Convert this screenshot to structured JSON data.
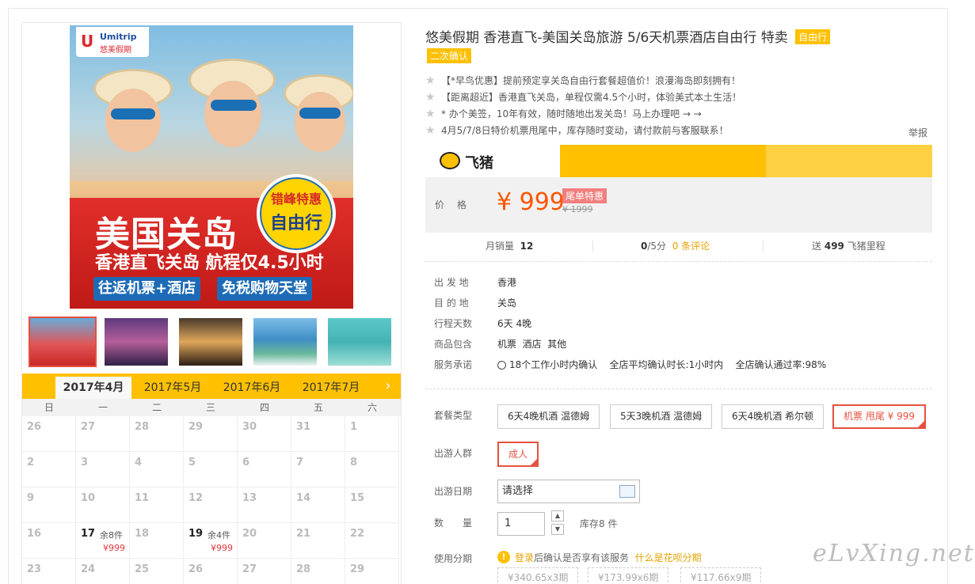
{
  "product": {
    "title": "悠美假期 香港直飞-美国关岛旅游 5/6天机票酒店自由行 特卖",
    "tag_free": "自由行",
    "tag_confirm": "二次确认",
    "bullets": [
      "【*早鸟优惠】提前预定享关岛自由行套餐超值价！浪漫海岛即刻拥有！",
      "【距离超近】香港直飞关岛，单程仅需4.5个小时，体验美式本土生活！",
      "* 办个美签，10年有效，随时随地出发关岛！马上办理吧 → →",
      "4月5/7/8日特价机票甩尾中，库存随时变动，请付款前与客服联系！"
    ],
    "report": "举报"
  },
  "main_image": {
    "logo_u": "U",
    "logo_text": "Umitrip",
    "logo_sub": "悠美假期",
    "headline": "美国关岛",
    "subline": "香港直飞关岛 航程仅4.5小时",
    "pill_left": "往返机票+酒店",
    "pill_right": "免税购物天堂",
    "badge_top": "错峰特惠",
    "badge_main": "自由行"
  },
  "brand": {
    "name": "飞猪"
  },
  "price": {
    "label": "价格",
    "current": "¥ 999",
    "tag": "尾单特惠",
    "original": "¥ 1999"
  },
  "stats": {
    "sales_label": "月销量",
    "sales_value": "12",
    "rating_value": "0",
    "rating_suffix": "/5分",
    "reviews": "0 条评论",
    "miles_prefix": "送",
    "miles_value": "499",
    "miles_suffix": "飞猪里程"
  },
  "info": [
    {
      "k": "出 发 地",
      "v": "香港"
    },
    {
      "k": "目 的 地",
      "v": "关岛"
    },
    {
      "k": "行程天数",
      "v": "6天 4晚"
    },
    {
      "k": "商品包含",
      "v": "机票  酒店  其他"
    },
    {
      "k": "服务承诺",
      "v": "18个工作小时内确认    全店平均确认时长:1小时内    全店确认通过率:98%"
    }
  ],
  "options": {
    "package_label": "套餐类型",
    "packages": [
      "6天4晚机酒 温德姆",
      "5天3晚机酒 温德姆",
      "6天4晚机酒 希尔顿",
      "机票 甩尾 ¥ 999"
    ],
    "crowd_label": "出游人群",
    "crowd_value": "成人",
    "date_label": "出游日期",
    "date_value": "请选择",
    "qty_label": "数　　量",
    "qty_value": "1",
    "stock": "库存8 件",
    "installment_label": "使用分期",
    "installment_login": "登录",
    "installment_text": "后确认是否享有该服务",
    "installment_link": "什么是花呗分期",
    "installments": [
      "¥340.65x3期",
      "¥173.99x6期",
      "¥117.66x9期"
    ]
  },
  "calendar": {
    "tabs": [
      "2017年4月",
      "2017年5月",
      "2017年6月",
      "2017年7月"
    ],
    "next": "›",
    "weekdays": [
      "日",
      "一",
      "二",
      "三",
      "四",
      "五",
      "六"
    ],
    "rows": [
      [
        {
          "d": "26"
        },
        {
          "d": "27"
        },
        {
          "d": "28"
        },
        {
          "d": "29"
        },
        {
          "d": "30"
        },
        {
          "d": "31"
        },
        {
          "d": "1"
        }
      ],
      [
        {
          "d": "2"
        },
        {
          "d": "3"
        },
        {
          "d": "4"
        },
        {
          "d": "5"
        },
        {
          "d": "6"
        },
        {
          "d": "7"
        },
        {
          "d": "8"
        }
      ],
      [
        {
          "d": "9"
        },
        {
          "d": "10"
        },
        {
          "d": "11"
        },
        {
          "d": "12"
        },
        {
          "d": "13"
        },
        {
          "d": "14"
        },
        {
          "d": "15"
        }
      ],
      [
        {
          "d": "16"
        },
        {
          "d": "17",
          "rem": "余8件",
          "price": "¥999"
        },
        {
          "d": "18"
        },
        {
          "d": "19",
          "rem": "余4件",
          "price": "¥999"
        },
        {
          "d": "20"
        },
        {
          "d": "21"
        },
        {
          "d": "22"
        }
      ],
      [
        {
          "d": "23"
        },
        {
          "d": "24"
        },
        {
          "d": "25"
        },
        {
          "d": "26"
        },
        {
          "d": "27"
        },
        {
          "d": "28"
        },
        {
          "d": "29"
        }
      ]
    ]
  },
  "watermark": "eLvXing.net",
  "colors": {
    "accent": "#ffc000",
    "price": "#ff5500",
    "selected": "#e4513f"
  }
}
